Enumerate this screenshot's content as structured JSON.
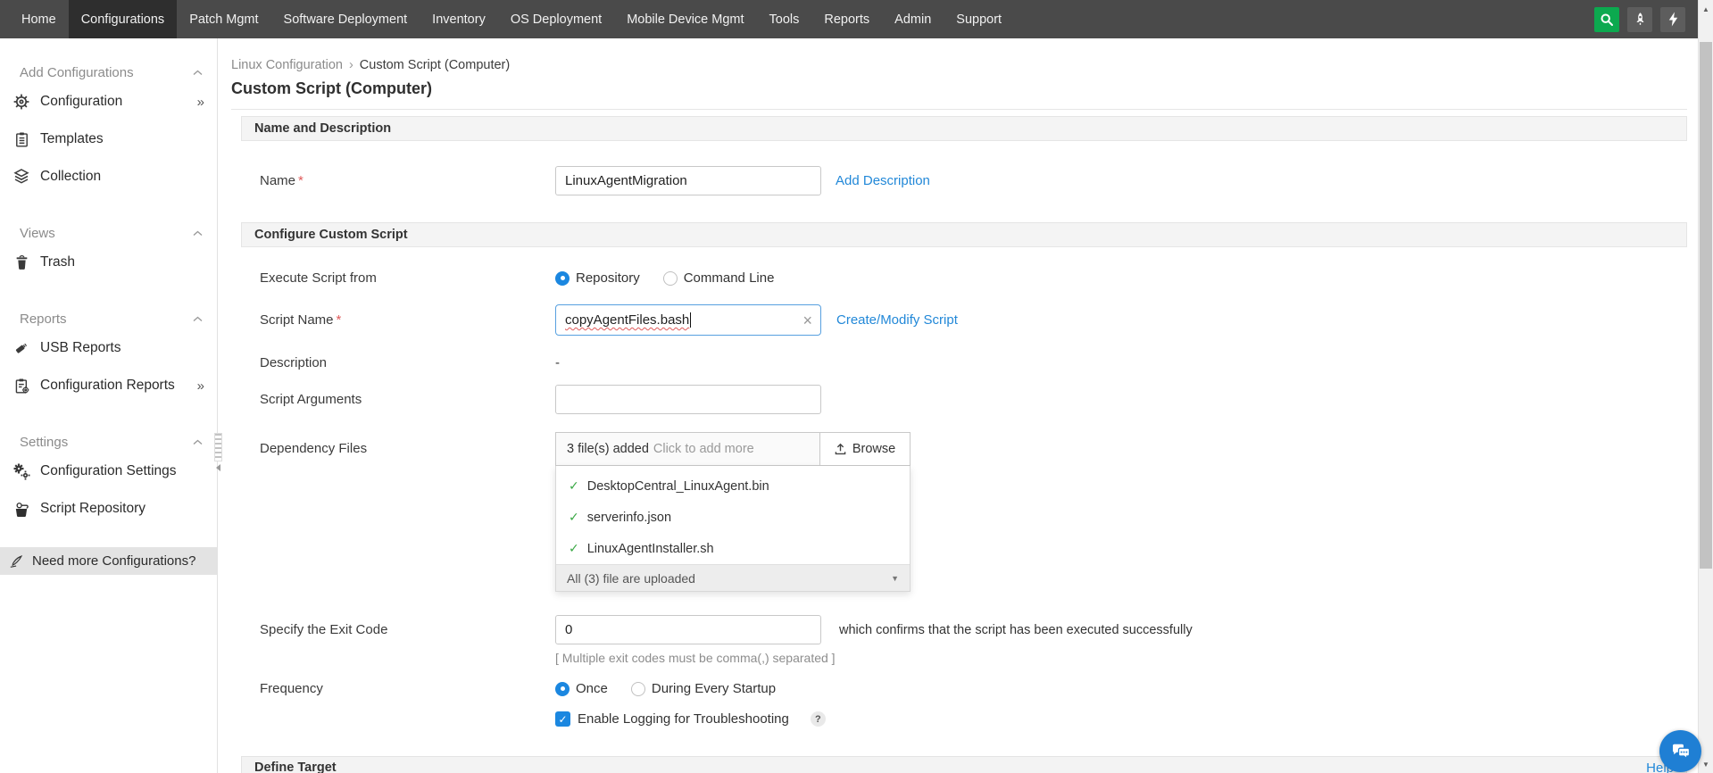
{
  "colors": {
    "nav_bg": "#4a4a4a",
    "nav_active_bg": "#2e2e2e",
    "search_green": "#0ca94f",
    "link_blue": "#2288d8",
    "radio_blue": "#1b87e0",
    "check_green": "#3aa845",
    "chat_blue": "#1f7fd4",
    "required_red": "#e05b5b"
  },
  "nav": {
    "items": [
      {
        "label": "Home"
      },
      {
        "label": "Configurations",
        "active": true
      },
      {
        "label": "Patch Mgmt"
      },
      {
        "label": "Software Deployment"
      },
      {
        "label": "Inventory"
      },
      {
        "label": "OS Deployment"
      },
      {
        "label": "Mobile Device Mgmt"
      },
      {
        "label": "Tools"
      },
      {
        "label": "Reports"
      },
      {
        "label": "Admin"
      },
      {
        "label": "Support"
      }
    ]
  },
  "sidebar": {
    "sections": [
      {
        "title": "Add Configurations",
        "items": [
          {
            "label": "Configuration",
            "icon": "gear-plus-icon",
            "expandable": true
          },
          {
            "label": "Templates",
            "icon": "clipboard-icon"
          },
          {
            "label": "Collection",
            "icon": "layers-plus-icon"
          }
        ]
      },
      {
        "title": "Views",
        "items": [
          {
            "label": "Trash",
            "icon": "trash-icon"
          }
        ]
      },
      {
        "title": "Reports",
        "items": [
          {
            "label": "USB Reports",
            "icon": "usb-icon"
          },
          {
            "label": "Configuration Reports",
            "icon": "clipboard-gear-icon",
            "expandable": true
          }
        ]
      },
      {
        "title": "Settings",
        "items": [
          {
            "label": "Configuration Settings",
            "icon": "gears-icon"
          },
          {
            "label": "Script Repository",
            "icon": "script-repository-icon"
          }
        ]
      }
    ],
    "more_marker": "»",
    "footer": {
      "label": "Need more Configurations?",
      "icon": "quill-icon"
    }
  },
  "breadcrumb": {
    "parent": "Linux Configuration",
    "separator": "›",
    "current": "Custom Script (Computer)"
  },
  "page": {
    "title": "Custom Script (Computer)"
  },
  "name_section": {
    "title": "Name and Description",
    "name_label": "Name",
    "required_mark": "*",
    "name_value": "LinuxAgentMigration",
    "add_description_link": "Add Description"
  },
  "script_section": {
    "title": "Configure Custom Script",
    "execute_from": {
      "label": "Execute Script from",
      "options": [
        {
          "label": "Repository",
          "selected": true
        },
        {
          "label": "Command Line",
          "selected": false
        }
      ]
    },
    "script_name": {
      "label": "Script Name",
      "required_mark": "*",
      "value": "copyAgentFiles.bash",
      "clear_icon": "×",
      "link": "Create/Modify Script"
    },
    "description": {
      "label": "Description",
      "value": "-"
    },
    "script_arguments": {
      "label": "Script Arguments",
      "value": ""
    },
    "dependency_files": {
      "label": "Dependency Files",
      "count_text": "3 file(s) added",
      "add_more_text": "Click to add more",
      "browse_label": "Browse",
      "files": [
        {
          "name": "DesktopCentral_LinuxAgent.bin",
          "status": "uploaded",
          "check_icon": "✓"
        },
        {
          "name": "serverinfo.json",
          "status": "uploaded",
          "check_icon": "✓"
        },
        {
          "name": "LinuxAgentInstaller.sh",
          "status": "uploaded",
          "check_icon": "✓"
        }
      ],
      "footer_text": "All (3) file are uploaded",
      "footer_arrow": "▼"
    },
    "exit_code": {
      "label": "Specify the Exit Code",
      "value": "0",
      "confirm_text": "which confirms that the script has been executed successfully",
      "note": "[ Multiple exit codes must be comma(,) separated ]"
    },
    "frequency": {
      "label": "Frequency",
      "options": [
        {
          "label": "Once",
          "selected": true
        },
        {
          "label": "During Every Startup",
          "selected": false
        }
      ]
    },
    "logging": {
      "label": "Enable Logging for Troubleshooting",
      "checked": true,
      "help_mark": "?"
    }
  },
  "target_section": {
    "title": "Define Target",
    "help_link": "Help"
  },
  "scrollbar": {
    "up_arrow": "▲",
    "down_arrow": "▼"
  }
}
